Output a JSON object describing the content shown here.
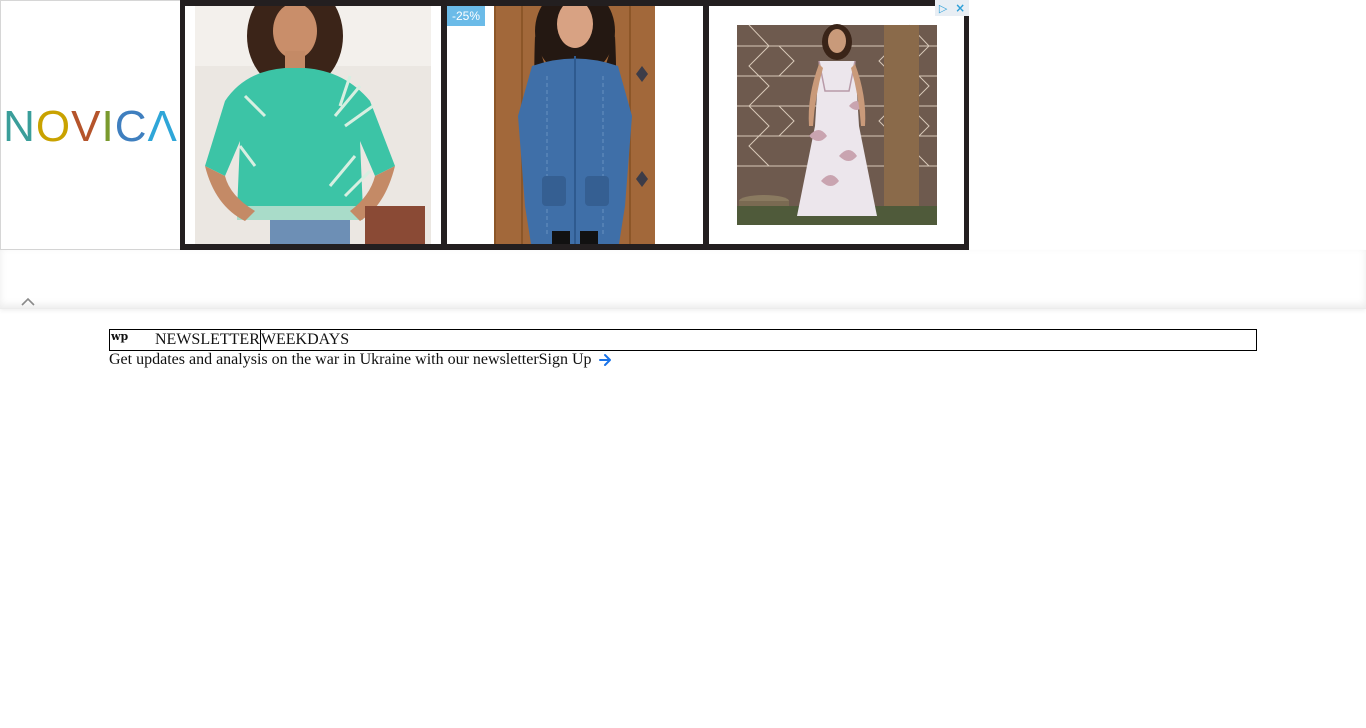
{
  "ad": {
    "logo": {
      "letters": [
        {
          "char": "N",
          "color": "#3a9e9a"
        },
        {
          "char": "O",
          "color": "#c9a200"
        },
        {
          "char": "V",
          "color": "#b5542b"
        },
        {
          "char": "I",
          "color": "#7a9a2e"
        },
        {
          "char": "C",
          "color": "#3f7fbf"
        },
        {
          "char": "Λ",
          "color": "#2fa6d8"
        }
      ]
    },
    "discount_badge": "-25%",
    "products": [
      {
        "name": "teal-leaf-print-blouse"
      },
      {
        "name": "blue-embroidered-tunic"
      },
      {
        "name": "white-floral-maxi-dress"
      }
    ],
    "ad_choices_icon": "ad-choices-icon",
    "close_icon": "close-icon"
  },
  "collapse": {
    "icon": "chevron-up-icon"
  },
  "newsletter": {
    "logo_text": "wp",
    "label": "NEWSLETTER",
    "frequency": "WEEKDAYS",
    "description": "Get updates and analysis on the war in Ukraine with our newsletter",
    "signup_label": "Sign Up",
    "signup_icon": "arrow-right-icon",
    "arrow_color": "#1a73e8"
  },
  "colors": {
    "ad_background": "#231f20",
    "badge": "#6bbbe8",
    "ad_choices": "#2fa0d8"
  }
}
